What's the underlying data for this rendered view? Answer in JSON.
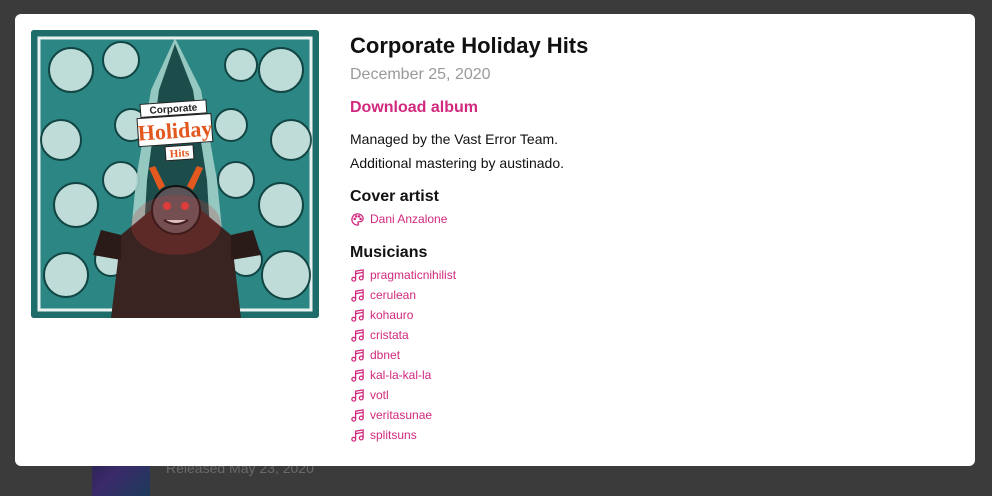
{
  "background": {
    "peek_text": "Released May 23, 2020"
  },
  "album": {
    "title": "Corporate Holiday Hits",
    "date": "December 25, 2020",
    "download_label": "Download album",
    "description": [
      "Managed by the Vast Error Team.",
      "Additional mastering by austinado."
    ],
    "cover_text": [
      "Corporate",
      "Holiday",
      "Hits"
    ]
  },
  "cover_artist": {
    "heading": "Cover artist",
    "icon": "palette-icon",
    "name": "Dani Anzalone"
  },
  "musicians": {
    "heading": "Musicians",
    "icon": "music-note-icon",
    "names": [
      "pragmaticnihilist",
      "cerulean",
      "kohauro",
      "cristata",
      "dbnet",
      "kal-la-kal-la",
      "votl",
      "veritasunae",
      "splitsuns"
    ]
  },
  "colors": {
    "accent": "#d1297d",
    "overlay": "#3b3b3b",
    "cover_teal": "#1f6d6a"
  }
}
